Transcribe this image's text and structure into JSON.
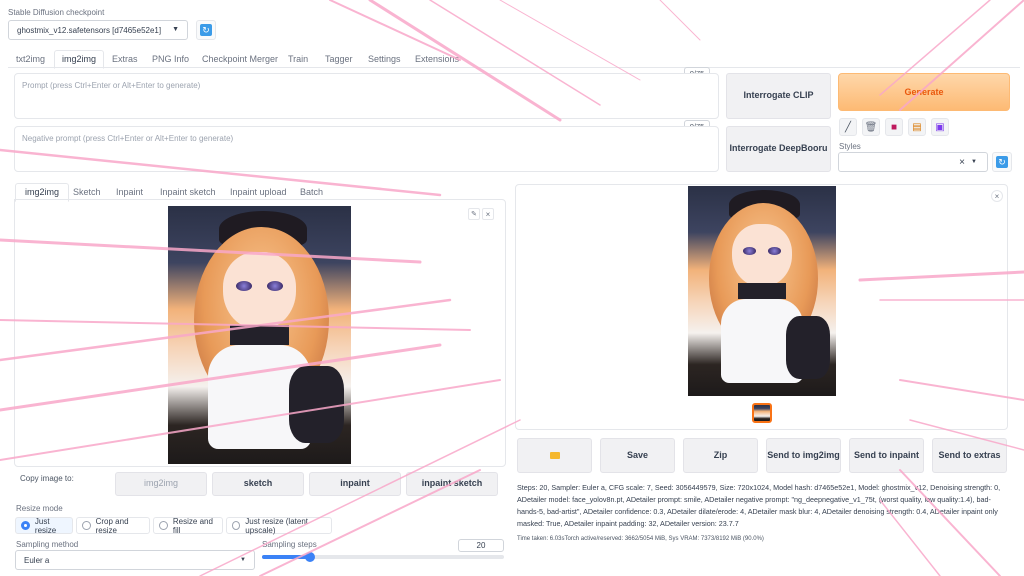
{
  "checkpoint": {
    "label": "Stable Diffusion checkpoint",
    "value": "ghostmix_v12.safetensors [d7465e52e1]"
  },
  "tabs": [
    "txt2img",
    "img2img",
    "Extras",
    "PNG Info",
    "Checkpoint Merger",
    "Train",
    "Tagger",
    "Settings",
    "Extensions"
  ],
  "prompt": {
    "placeholder": "Prompt (press Ctrl+Enter or Alt+Enter to generate)",
    "counter": "0/75"
  },
  "negative_prompt": {
    "placeholder": "Negative prompt (press Ctrl+Enter or Alt+Enter to generate)",
    "counter": "0/75"
  },
  "interrogate_clip": "Interrogate CLIP",
  "interrogate_deepbooru": "Interrogate DeepBooru",
  "generate": "Generate",
  "styles_label": "Styles",
  "styles_clear": "×",
  "input_tabs": [
    "img2img",
    "Sketch",
    "Inpaint",
    "Inpaint sketch",
    "Inpaint upload",
    "Batch"
  ],
  "copy_label": "Copy image to:",
  "copy_buttons": [
    "img2img",
    "sketch",
    "inpaint",
    "inpaint sketch"
  ],
  "resize_mode": {
    "label": "Resize mode",
    "options": [
      "Just resize",
      "Crop and resize",
      "Resize and fill",
      "Just resize (latent upscale)"
    ],
    "selected": "Just resize"
  },
  "sampling_method": {
    "label": "Sampling method",
    "value": "Euler a"
  },
  "sampling_steps": {
    "label": "Sampling steps",
    "value": "20",
    "fraction": 0.2
  },
  "output_buttons": [
    "Save",
    "Zip",
    "Send to img2img",
    "Send to inpaint",
    "Send to extras"
  ],
  "generation_info": "Steps: 20, Sampler: Euler a, CFG scale: 7, Seed: 3056449579, Size: 720x1024, Model hash: d7465e52e1, Model: ghostmix_v12, Denoising strength: 0, ADetailer model: face_yolov8n.pt, ADetailer prompt: smile, ADetailer negative prompt: \"ng_deepnegative_v1_75t, (worst quality, low quality:1.4), bad-hands-5, bad-artist\", ADetailer confidence: 0.3, ADetailer dilate/erode: 4, ADetailer mask blur: 4, ADetailer denoising strength: 0.4, ADetailer inpaint only masked: True, ADetailer inpaint padding: 32, ADetailer version: 23.7.7",
  "time_info": "Time taken: 6.03sTorch active/reserved: 3662/5054 MiB, Sys VRAM: 7373/8192 MiB (90.0%)",
  "icons": {
    "refresh": "refresh-icon",
    "folder": "folder-icon",
    "pencil": "pencil-icon",
    "trash": "trash-icon",
    "book": "book-icon",
    "clipboard": "clipboard-icon",
    "save": "save-icon"
  },
  "colors": {
    "generate_bg": "#fdba74",
    "generate_text": "#ea580c",
    "accent": "#3b82f6",
    "streaks": "#f9a8c9"
  }
}
